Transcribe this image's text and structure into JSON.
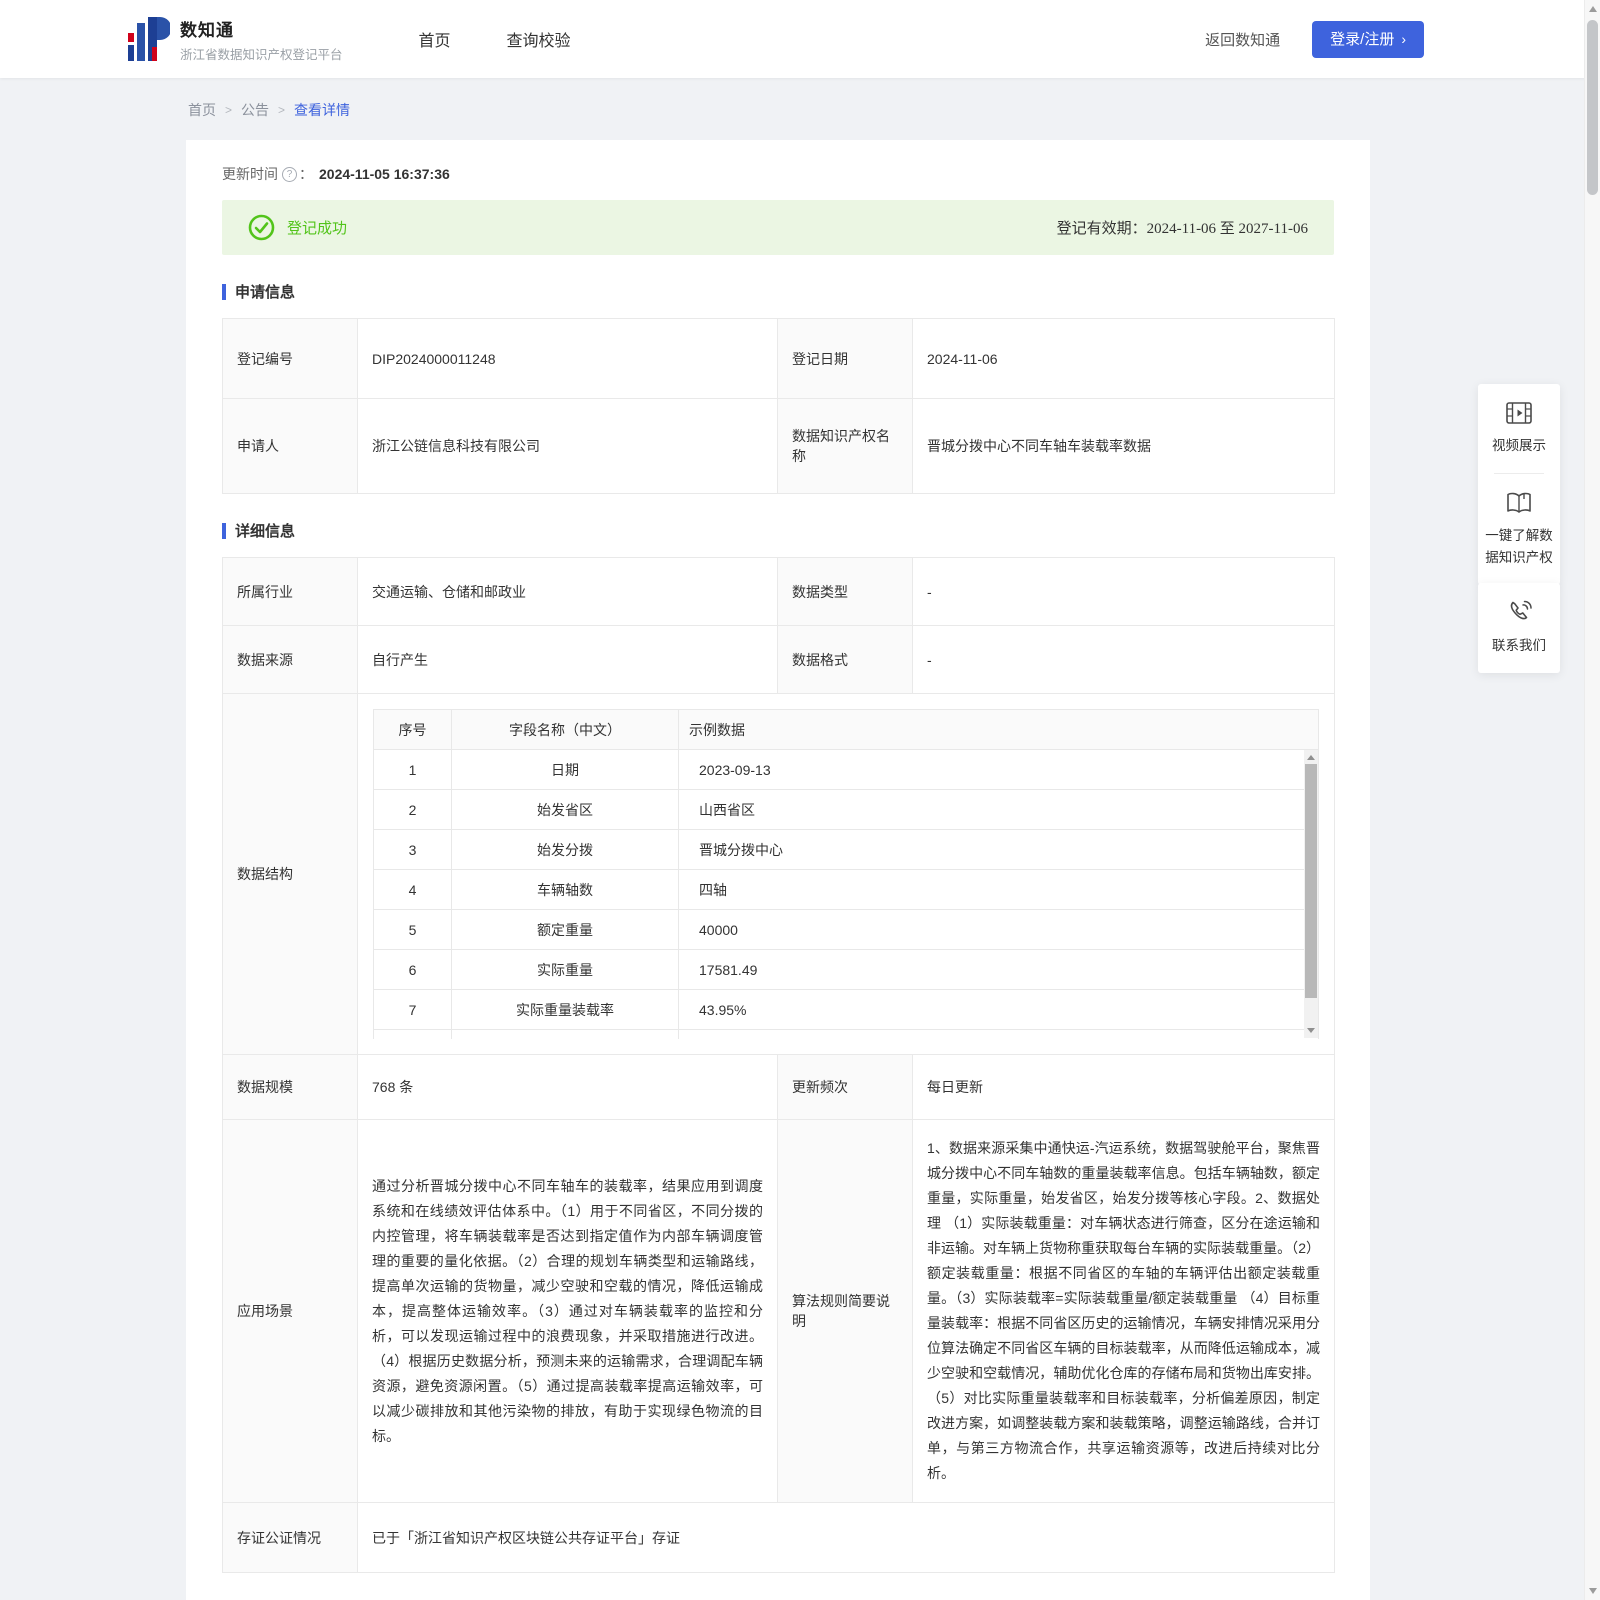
{
  "icons": {
    "help_glyph": "?"
  },
  "header": {
    "brand_name": "数知通",
    "brand_subtitle": "浙江省数据知识产权登记平台",
    "nav": {
      "home": "首页",
      "verify": "查询校验"
    },
    "back_link": "返回数知通",
    "login_button": "登录/注册",
    "login_arrow": "›",
    "accent_color": "#3e63dd"
  },
  "breadcrumb": {
    "items": [
      "首页",
      "公告",
      "查看详情"
    ],
    "separator": ">"
  },
  "meta": {
    "update_time_label": "更新时间",
    "colon": "：",
    "update_time": "2024-11-05 16:37:36"
  },
  "banner": {
    "status": "登记成功",
    "validity_label": "登记有效期：",
    "validity": "2024-11-06 至 2027-11-06",
    "status_color": "#52c41a"
  },
  "sections": {
    "application": "申请信息",
    "detail": "详细信息"
  },
  "application": {
    "reg_no_label": "登记编号",
    "reg_no": "DIP2024000011248",
    "reg_date_label": "登记日期",
    "reg_date": "2024-11-06",
    "applicant_label": "申请人",
    "applicant": "浙江公链信息科技有限公司",
    "ip_name_label": "数据知识产权名称",
    "ip_name": "晋城分拨中心不同车轴车装载率数据"
  },
  "detail": {
    "industry_label": "所属行业",
    "industry": "交通运输、仓储和邮政业",
    "data_type_label": "数据类型",
    "data_type": "-",
    "source_label": "数据来源",
    "source": "自行产生",
    "format_label": "数据格式",
    "format": "-",
    "structure_label": "数据结构",
    "structure_table": {
      "headers": [
        "序号",
        "字段名称（中文）",
        "示例数据"
      ],
      "rows": [
        [
          "1",
          "日期",
          "2023-09-13"
        ],
        [
          "2",
          "始发省区",
          "山西省区"
        ],
        [
          "3",
          "始发分拨",
          "晋城分拨中心"
        ],
        [
          "4",
          "车辆轴数",
          "四轴"
        ],
        [
          "5",
          "额定重量",
          "40000"
        ],
        [
          "6",
          "实际重量",
          "17581.49"
        ],
        [
          "7",
          "实际重量装载率",
          "43.95%"
        ]
      ]
    },
    "scale_label": "数据规模",
    "scale": "768 条",
    "frequency_label": "更新频次",
    "frequency": "每日更新",
    "scenario_label": "应用场景",
    "scenario": "通过分析晋城分拨中心不同车轴车的装载率，结果应用到调度系统和在线绩效评估体系中。（1）用于不同省区，不同分拨的内控管理，将车辆装载率是否达到指定值作为内部车辆调度管理的重要的量化依据。（2）合理的规划车辆类型和运输路线，提高单次运输的货物量，减少空驶和空载的情况，降低运输成本，提高整体运输效率。（3）通过对车辆装载率的监控和分析，可以发现运输过程中的浪费现象，并采取措施进行改进。（4）根据历史数据分析，预测未来的运输需求，合理调配车辆资源，避免资源闲置。（5）通过提高装载率提高运输效率，可以减少碳排放和其他污染物的排放，有助于实现绿色物流的目标。",
    "algorithm_label": "算法规则简要说明",
    "algorithm": "1、数据来源采集中通快运-汽运系统，数据驾驶舱平台，聚焦晋城分拨中心不同车轴数的重量装载率信息。包括车辆轴数，额定重量，实际重量，始发省区，始发分拨等核心字段。2、数据处理 （1）实际装载重量：对车辆状态进行筛查，区分在途运输和非运输。对车辆上货物称重获取每台车辆的实际装载重量。（2）额定装载重量：根据不同省区的车轴的车辆评估出额定装载重量。（3）实际装载率=实际装载重量/额定装载重量 （4）目标重量装载率：根据不同省区历史的运输情况，车辆安排情况采用分位算法确定不同省区车辆的目标装载率，从而降低运输成本，减少空驶和空载情况，辅助优化仓库的存储布局和货物出库安排。（5）对比实际重量装载率和目标装载率，分析偏差原因，制定改进方案，如调整装载方案和装载策略，调整运输路线，合并订单，与第三方物流合作，共享运输资源等，改进后持续对比分析。",
    "notary_label": "存证公证情况",
    "notary": "已于「浙江省知识产权区块链公共存证平台」存证"
  },
  "floating": {
    "video": "视频展示",
    "guide": "一键了解数据知识产权",
    "contact": "联系我们"
  }
}
